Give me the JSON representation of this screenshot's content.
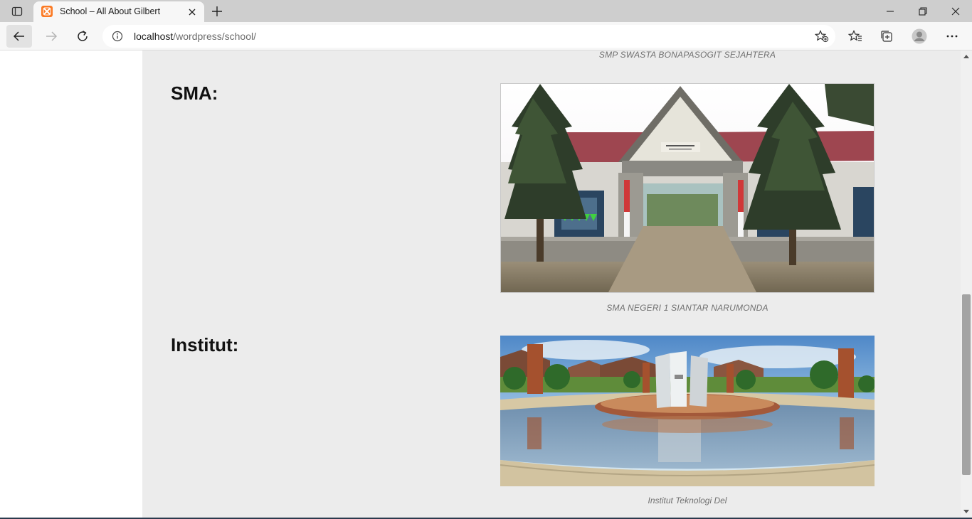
{
  "browser": {
    "tab": {
      "title": "School – All About Gilbert",
      "favicon": "xampp-icon"
    },
    "address": {
      "host": "localhost",
      "path": "/wordpress/school/"
    },
    "icons": {
      "tab_actions": "tab-actions-icon",
      "new_tab": "plus-icon",
      "minimize": "minimize-icon",
      "restore": "restore-icon",
      "close": "close-icon",
      "back": "back-arrow-icon",
      "forward": "forward-arrow-icon",
      "reload": "reload-icon",
      "site_info": "info-icon",
      "add_favorite": "star-plus-icon",
      "favorites": "favorites-icon",
      "collections": "collections-icon",
      "profile": "profile-avatar",
      "menu": "more-icon"
    },
    "accent": "#fb7a24"
  },
  "page": {
    "smp_caption": "SMP SWASTA BONAPASOGIT SEJAHTERA",
    "sma_heading": "SMA:",
    "sma_caption": "SMA NEGERI 1 SIANTAR NARUMONDA",
    "institut_heading": "Institut:",
    "institut_caption": "Institut Teknologi Del",
    "background": "#ececec"
  }
}
